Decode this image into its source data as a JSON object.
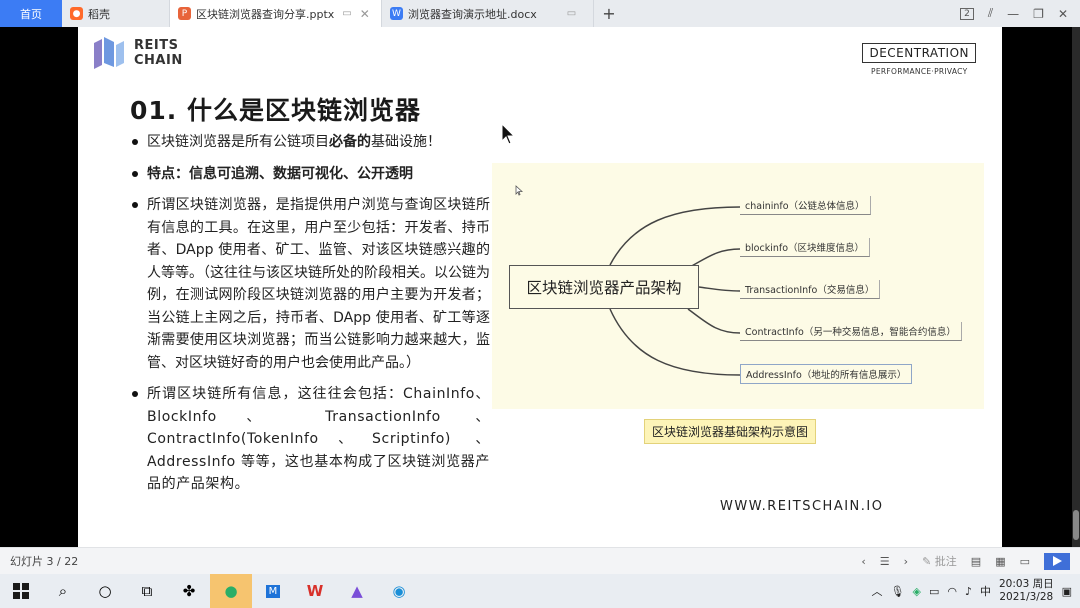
{
  "tabs": {
    "home": "首页",
    "items": [
      {
        "label": "稻壳",
        "icon": "daoke-icon"
      },
      {
        "label": "区块链浏览器查询分享.pptx",
        "icon": "ppt-icon"
      },
      {
        "label": "浏览器查询演示地址.docx",
        "icon": "word-icon"
      }
    ],
    "add_label": "+",
    "badge": "2"
  },
  "slide": {
    "logo_line1": "REITS",
    "logo_line2": "CHAIN",
    "badge_title": "DECENTRATION",
    "badge_sub": "PERFORMANCE·PRIVACY",
    "title": "01. 什么是区块链浏览器",
    "bullet1_pre": "区块链浏览器是所有公链项目",
    "bullet1_bold": "必备的",
    "bullet1_post": "基础设施！",
    "bullet2": "特点：信息可追溯、数据可视化、公开透明",
    "bullet3": "所谓区块链浏览器，是指提供用户浏览与查询区块链所有信息的工具。在这里，用户至少包括：开发者、持币者、DApp 使用者、矿工、监管、对该区块链感兴趣的人等等。（这往往与该区块链所处的阶段相关。以公链为例，在测试网阶段区块链浏览器的用户主要为开发者；当公链上主网之后，持币者、DApp 使用者、矿工等逐渐需要使用区块浏览器；而当公链影响力越来越大，监管、对区块链好奇的用户也会使用此产品。）",
    "bullet4": "所谓区块链所有信息，这往往会包括：ChainInfo、BlockInfo、 TransactionInfo 、ContractInfo(TokenInfo、Scriptinfo) 、AddressInfo 等等，这也基本构成了区块链浏览器产品的产品架构。",
    "diagram": {
      "root": "区块链浏览器产品架构",
      "branches": [
        "chaininfo（公链总体信息）",
        "blockinfo（区块维度信息）",
        "TransactionInfo（交易信息）",
        "ContractInfo（另一种交易信息，智能合约信息）",
        "AddressInfo（地址的所有信息展示）"
      ]
    },
    "caption": "区块链浏览器基础架构示意图",
    "website": "WWW.REITSCHAIN.IO"
  },
  "status": {
    "slide_counter": "幻灯片 3 / 22",
    "comment_label": "批注"
  },
  "taskbar": {
    "ime": "中",
    "time": "20:03 周日",
    "date": "2021/3/28"
  },
  "colors": {
    "accent": "#3c7cf4",
    "diagram_bg": "#fdfbe6",
    "caption_bg": "#fdf4b8"
  }
}
